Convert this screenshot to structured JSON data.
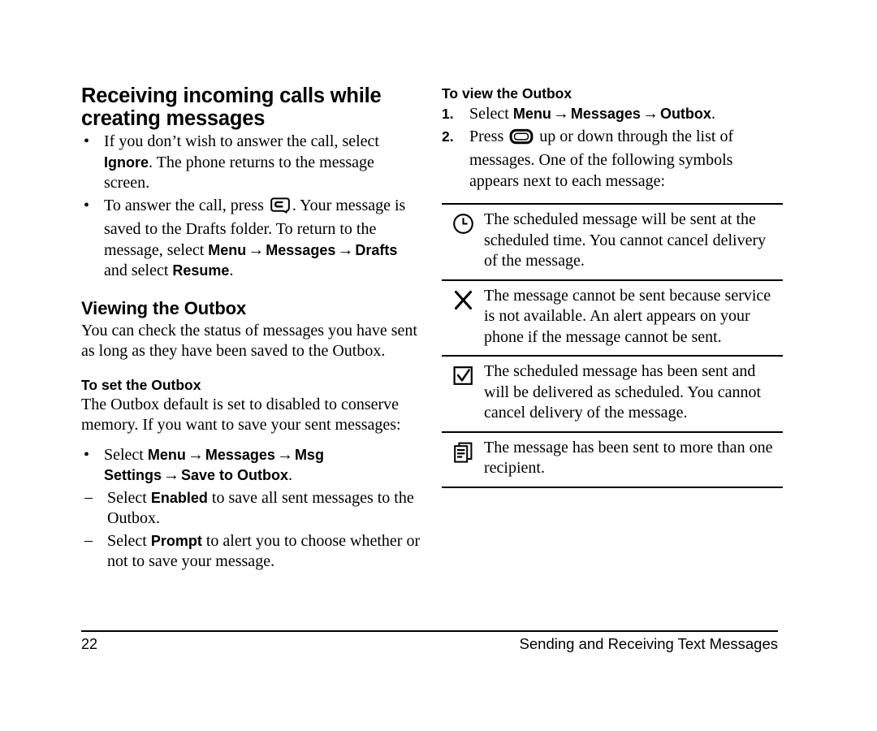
{
  "document": {
    "type": "phone-user-manual-page"
  },
  "left_column": {
    "section_title": "Receiving incoming calls while creating messages",
    "bullets": [
      {
        "parts": [
          {
            "t": "text",
            "v": "If you don’t wish to answer the call, select "
          },
          {
            "t": "ui",
            "v": "Ignore"
          },
          {
            "t": "text",
            "v": ". The phone returns to the message screen."
          }
        ]
      },
      {
        "parts": [
          {
            "t": "text",
            "v": "To answer the call, press "
          },
          {
            "t": "icon",
            "v": "send-key-icon"
          },
          {
            "t": "text",
            "v": ". Your message is saved to the Drafts folder. To return to the message, select "
          },
          {
            "t": "ui",
            "v": "Menu"
          },
          {
            "t": "arrow",
            "v": "→"
          },
          {
            "t": "ui",
            "v": "Messages"
          },
          {
            "t": "arrow",
            "v": "→"
          },
          {
            "t": "ui",
            "v": "Drafts"
          },
          {
            "t": "text",
            "v": " and select "
          },
          {
            "t": "ui",
            "v": "Resume"
          },
          {
            "t": "text",
            "v": "."
          }
        ]
      }
    ],
    "viewing_outbox": {
      "title": "Viewing the Outbox",
      "intro": "You can check the status of messages you have sent as long as they have been saved to the Outbox."
    },
    "set_outbox": {
      "title": "To set the Outbox",
      "intro": "The Outbox default is set to disabled to conserve memory. If you want to save your sent messages:",
      "bullet": {
        "parts": [
          {
            "t": "text",
            "v": "Select "
          },
          {
            "t": "ui",
            "v": "Menu"
          },
          {
            "t": "arrow",
            "v": "→"
          },
          {
            "t": "ui",
            "v": "Messages"
          },
          {
            "t": "arrow",
            "v": "→"
          },
          {
            "t": "ui",
            "v": "Msg Settings"
          },
          {
            "t": "arrow",
            "v": "→"
          },
          {
            "t": "ui",
            "v": "Save to Outbox"
          },
          {
            "t": "text",
            "v": "."
          }
        ]
      },
      "sub_items": [
        {
          "parts": [
            {
              "t": "text",
              "v": "Select "
            },
            {
              "t": "ui",
              "v": "Enabled"
            },
            {
              "t": "text",
              "v": " to save all sent messages to the Outbox."
            }
          ]
        },
        {
          "parts": [
            {
              "t": "text",
              "v": "Select "
            },
            {
              "t": "ui",
              "v": "Prompt"
            },
            {
              "t": "text",
              "v": " to alert you to choose whether or not to save your message."
            }
          ]
        }
      ]
    }
  },
  "right_column": {
    "view_outbox": {
      "title": "To view the Outbox",
      "steps": [
        {
          "number": "1.",
          "parts": [
            {
              "t": "text",
              "v": "Select "
            },
            {
              "t": "ui",
              "v": "Menu"
            },
            {
              "t": "arrow",
              "v": "→"
            },
            {
              "t": "ui",
              "v": "Messages"
            },
            {
              "t": "arrow",
              "v": "→"
            },
            {
              "t": "ui",
              "v": "Outbox"
            },
            {
              "t": "text",
              "v": "."
            }
          ]
        },
        {
          "number": "2.",
          "parts": [
            {
              "t": "text",
              "v": "Press "
            },
            {
              "t": "icon",
              "v": "navigation-key-icon"
            },
            {
              "t": "text",
              "v": " up or down through the list of messages. One of the following symbols appears next to each message:"
            }
          ]
        }
      ]
    },
    "symbol_table": {
      "rows": [
        {
          "icon": "clock-icon",
          "text": "The scheduled message will be sent at the scheduled time. You cannot cancel delivery of the message."
        },
        {
          "icon": "x-mark-icon",
          "text": "The message cannot be sent because service is not available. An alert appears on your phone if the message cannot be sent."
        },
        {
          "icon": "checkbox-checked-icon",
          "text": "The scheduled message has been sent and will be delivered as scheduled. You cannot cancel delivery of the message."
        },
        {
          "icon": "multiple-documents-icon",
          "text": "The message has been sent to more than one recipient."
        }
      ]
    }
  },
  "footer": {
    "page_number": "22",
    "chapter": "Sending and Receiving Text Messages"
  },
  "colors": {
    "text": "#000000",
    "background": "#ffffff",
    "rule": "#000000"
  }
}
